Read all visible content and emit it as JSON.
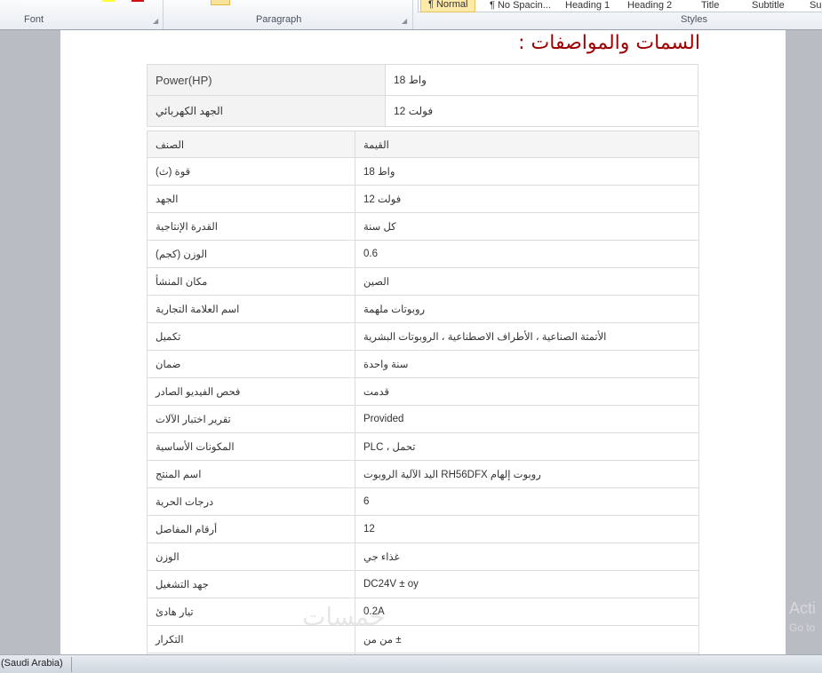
{
  "ribbon": {
    "groups": [
      "Font",
      "Paragraph",
      "Styles"
    ],
    "styles": [
      "¶ Normal",
      "¶ No Spacin...",
      "Heading 1",
      "Heading 2",
      "Title",
      "Subtitle",
      "Su"
    ]
  },
  "document": {
    "title": "السمات والمواصفات :",
    "summary_table": [
      {
        "key": "Power(HP)",
        "value": "واط 18"
      },
      {
        "key": "الجهد الكهربائي",
        "value": "فولت 12"
      }
    ],
    "spec_header": {
      "key": "الصنف",
      "value": "القيمة"
    },
    "spec_rows": [
      {
        "key": "قوة (ث)",
        "value": "واط 18"
      },
      {
        "key": "الجهد",
        "value": "فولت 12"
      },
      {
        "key": "القدرة الإنتاجية",
        "value": "كل سنة"
      },
      {
        "key": "الوزن (كجم)",
        "value": "0.6"
      },
      {
        "key": "مكان المنشأ",
        "value": "الصين"
      },
      {
        "key": "اسم العلامة التجارية",
        "value": "روبوتات ملهمة"
      },
      {
        "key": "تكميل",
        "value": "الأتمتة الصناعية ، الأطراف الاصطناعية ، الروبوتات البشرية"
      },
      {
        "key": "ضمان",
        "value": "سنة واحدة"
      },
      {
        "key": "فحص الفيديو الصادر",
        "value": "قدمت"
      },
      {
        "key": "تقرير اختبار الآلات",
        "value": "Provided"
      },
      {
        "key": "المكونات الأساسية",
        "value": "PLC ، تحمل"
      },
      {
        "key": "اسم المنتج",
        "value": "اليد الآلية الروبوت RH56DFX روبوت إلهام"
      },
      {
        "key": "درجات الحرية",
        "value": "6"
      },
      {
        "key": "أرقام المفاصل",
        "value": "12"
      },
      {
        "key": "الوزن",
        "value": "غذاء جي"
      },
      {
        "key": "جهد التشغيل",
        "value": "DC24V ± oy"
      },
      {
        "key": "تيار هادئ",
        "value": "0.2A"
      },
      {
        "key": "التكرار",
        "value": "من من ±"
      }
    ]
  },
  "watermark": "خمسات",
  "activation": {
    "line1": "Acti",
    "line2": "Go to"
  },
  "status": {
    "language": "(Saudi Arabia)"
  }
}
